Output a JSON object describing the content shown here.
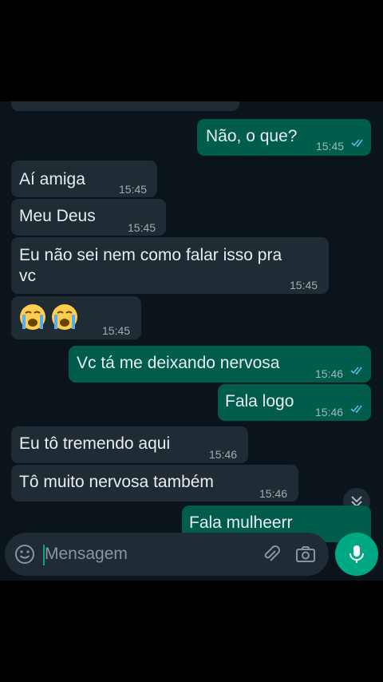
{
  "messages": [
    {
      "direction": "out",
      "text": "Não, o que?",
      "time": "15:45",
      "status": "read"
    },
    {
      "direction": "in",
      "text": "Aí amiga",
      "time": "15:45"
    },
    {
      "direction": "in",
      "text": "Meu Deus",
      "time": "15:45"
    },
    {
      "direction": "in",
      "line1": "Eu não sei nem como falar isso pra",
      "line2": "vc",
      "time": "15:45"
    },
    {
      "direction": "in",
      "emoji": "loudly-crying-face x2",
      "time": "15:45"
    },
    {
      "direction": "out",
      "text": "Vc tá me deixando nervosa",
      "time": "15:46",
      "status": "read"
    },
    {
      "direction": "out",
      "text": "Fala logo",
      "time": "15:46",
      "status": "read"
    },
    {
      "direction": "in",
      "text": "Eu tô tremendo aqui",
      "time": "15:46"
    },
    {
      "direction": "in",
      "text": "Tô muito nervosa também",
      "time": "15:46"
    },
    {
      "direction": "out",
      "text": "Fala mulheerr",
      "time": "",
      "status": "read"
    }
  ],
  "composer": {
    "placeholder": "Mensagem"
  },
  "icons": {
    "emoji": "emoji-icon",
    "attach": "paperclip-icon",
    "camera": "camera-icon",
    "mic": "mic-icon",
    "scroll": "chevron-double-down-icon"
  },
  "colors": {
    "background": "#0b141a",
    "incoming": "#202c33",
    "outgoing": "#005c4b",
    "read_ticks": "#53bdeb",
    "accent": "#00a884"
  }
}
